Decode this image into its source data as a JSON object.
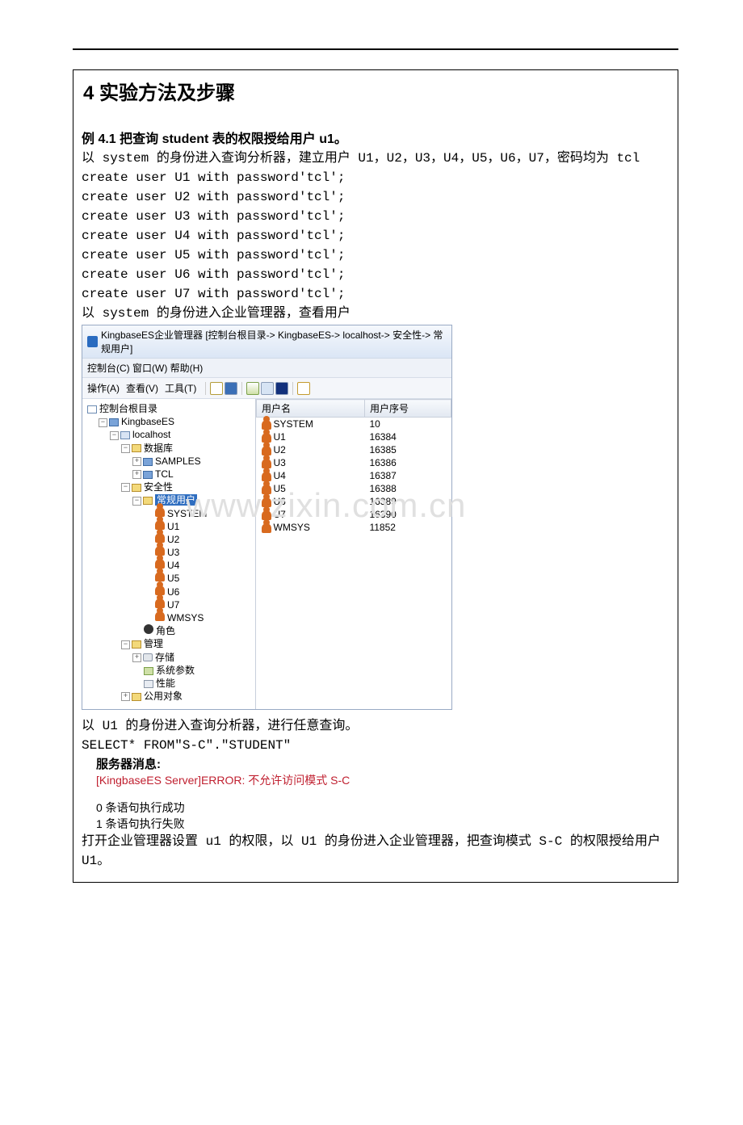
{
  "section_heading": "4  实验方法及步骤",
  "example_heading": "例 4.1 把查询 student 表的权限授给用户 u1。",
  "intro_line": "以 system 的身份进入查询分析器，建立用户 U1，U2，U3，U4，U5，U6，U7，密码均为 tcl",
  "sql_lines": [
    "create user U1 with password'tcl';",
    "create user U2 with password'tcl';",
    "create user U3 with password'tcl';",
    "create user U4 with password'tcl';",
    "create user U5 with password'tcl';",
    "create user U6 with password'tcl';",
    "create user U7 with password'tcl';"
  ],
  "after_sql_line": "以 system 的身份进入企业管理器，查看用户",
  "em": {
    "title": "KingbaseES企业管理器 [控制台根目录-> KingbaseES-> localhost-> 安全性-> 常规用户]",
    "menubar": "控制台(C)  窗口(W)  帮助(H)",
    "toolbar_menus": [
      "操作(A)",
      "查看(V)",
      "工具(T)"
    ],
    "tree": {
      "root": "控制台根目录",
      "kingbase": "KingbaseES",
      "host": "localhost",
      "database": "数据库",
      "db_items": [
        "SAMPLES",
        "TCL"
      ],
      "security": "安全性",
      "regular_users": "常规用户",
      "users": [
        "SYSTEM",
        "U1",
        "U2",
        "U3",
        "U4",
        "U5",
        "U6",
        "U7",
        "WMSYS"
      ],
      "role": "角色",
      "manage": "管理",
      "storage": "存储",
      "sysparam": "系统参数",
      "perf": "性能",
      "pub": "公用对象"
    },
    "list": {
      "col_user": "用户名",
      "col_id": "用户序号",
      "rows": [
        {
          "name": "SYSTEM",
          "id": "10"
        },
        {
          "name": "U1",
          "id": "16384"
        },
        {
          "name": "U2",
          "id": "16385"
        },
        {
          "name": "U3",
          "id": "16386"
        },
        {
          "name": "U4",
          "id": "16387"
        },
        {
          "name": "U5",
          "id": "16388"
        },
        {
          "name": "U6",
          "id": "16389"
        },
        {
          "name": "U7",
          "id": "16390"
        },
        {
          "name": "WMSYS",
          "id": "11852"
        }
      ]
    }
  },
  "watermark": "www.zixin.com.cn",
  "after_em_line1": "以 U1 的身份进入查询分析器，进行任意查询。",
  "after_em_sql": "SELECT* FROM\"S-C\".\"STUDENT\"",
  "server_msg_label": "服务器消息:",
  "error_line": "[KingbaseES Server]ERROR: 不允许访问模式 S-C",
  "stat_success": "0 条语句执行成功",
  "stat_fail": "1 条语句执行失败",
  "final_line": "打开企业管理器设置 u1 的权限，以 U1 的身份进入企业管理器，把查询模式 S-C 的权限授给用户 U1。"
}
